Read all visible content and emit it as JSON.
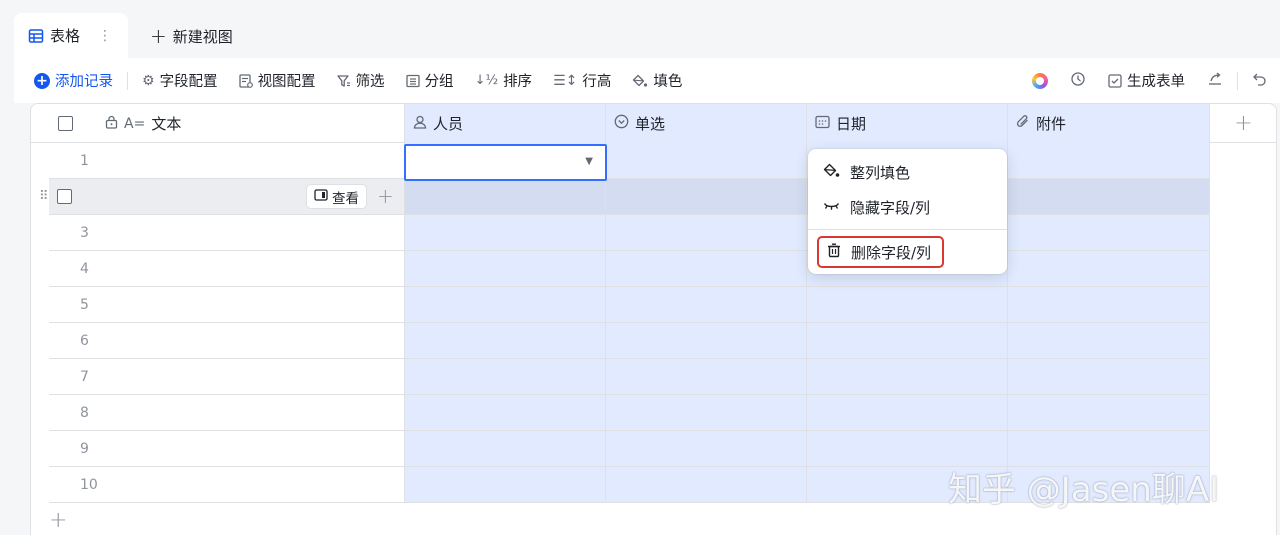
{
  "tabs": {
    "active": "表格",
    "new_view": "新建视图"
  },
  "toolbar": {
    "add_record": "添加记录",
    "field_config": "字段配置",
    "view_config": "视图配置",
    "filter": "筛选",
    "group": "分组",
    "sort": "排序",
    "row_height": "行高",
    "fill": "填色",
    "generate_form": "生成表单"
  },
  "columns": [
    {
      "label": "文本",
      "icon": "text-field-icon",
      "prefix": "A="
    },
    {
      "label": "人员",
      "icon": "person-icon"
    },
    {
      "label": "单选",
      "icon": "single-select-icon"
    },
    {
      "label": "日期",
      "icon": "calendar-icon"
    },
    {
      "label": "附件",
      "icon": "attachment-icon"
    }
  ],
  "rows": [
    "1",
    "",
    "3",
    "4",
    "5",
    "6",
    "7",
    "8",
    "9",
    "10"
  ],
  "row_view_button": "查看",
  "context_menu": {
    "fill_column": "整列填色",
    "hide_field": "隐藏字段/列",
    "delete_field": "删除字段/列"
  },
  "watermark": "知乎 @Jasen聊AI",
  "colors": {
    "accent": "#1456f0",
    "selected_column": "#e1eaff",
    "danger_outline": "#d83931"
  }
}
